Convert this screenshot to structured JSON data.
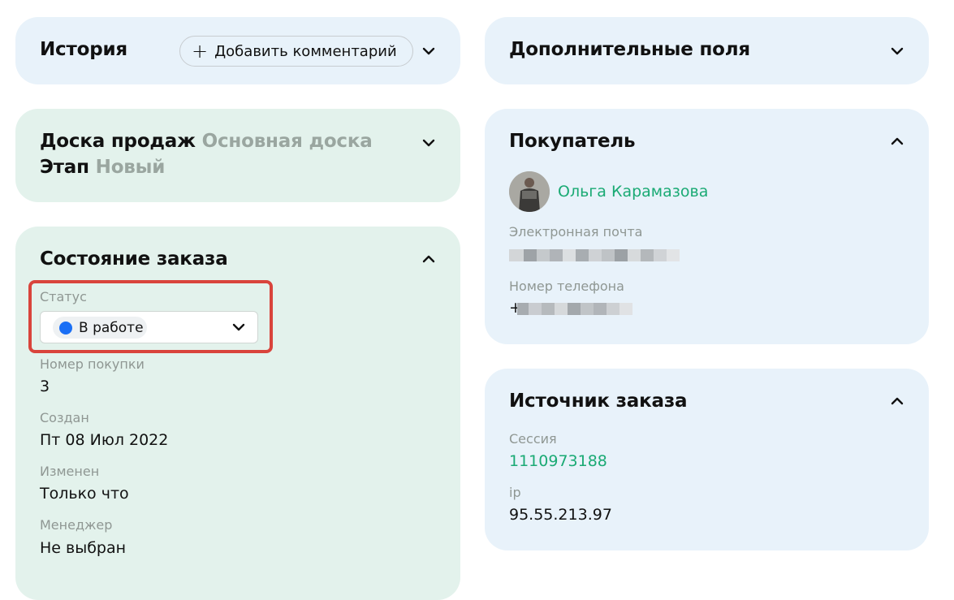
{
  "history": {
    "title": "История",
    "add_comment_label": "Добавить комментарий",
    "add_icon": "plus-icon",
    "toggle_icon": "chevron-down-icon"
  },
  "sales_board": {
    "board_label": "Доска продаж",
    "board_value": "Основная доска",
    "stage_label": "Этап",
    "stage_value": "Новый",
    "toggle_icon": "chevron-down-icon"
  },
  "order_state": {
    "title": "Состояние заказа",
    "toggle_icon": "chevron-up-icon",
    "status_label": "Статус",
    "status_value": "В работе",
    "status_color": "#1a6ff5",
    "purchase_number_label": "Номер покупки",
    "purchase_number_value": "3",
    "created_label": "Создан",
    "created_value": "Пт 08 Июл 2022",
    "modified_label": "Изменен",
    "modified_value": "Только что",
    "manager_label": "Менеджер",
    "manager_value": "Не выбран"
  },
  "extra_fields": {
    "title": "Дополнительные поля",
    "toggle_icon": "chevron-down-icon"
  },
  "buyer": {
    "title": "Покупатель",
    "toggle_icon": "chevron-up-icon",
    "name": "Ольга Карамазова",
    "email_label": "Электронная почта",
    "phone_label": "Номер телефона",
    "phone_prefix": "+"
  },
  "order_source": {
    "title": "Источник заказа",
    "toggle_icon": "chevron-up-icon",
    "session_label": "Сессия",
    "session_value": "1110973188",
    "ip_label": "ip",
    "ip_value": "95.55.213.97"
  },
  "colors": {
    "card_blue": "#e8f2fa",
    "card_green": "#e3f2ec",
    "link_green": "#1aaa74",
    "highlight_red": "#d9443c"
  }
}
